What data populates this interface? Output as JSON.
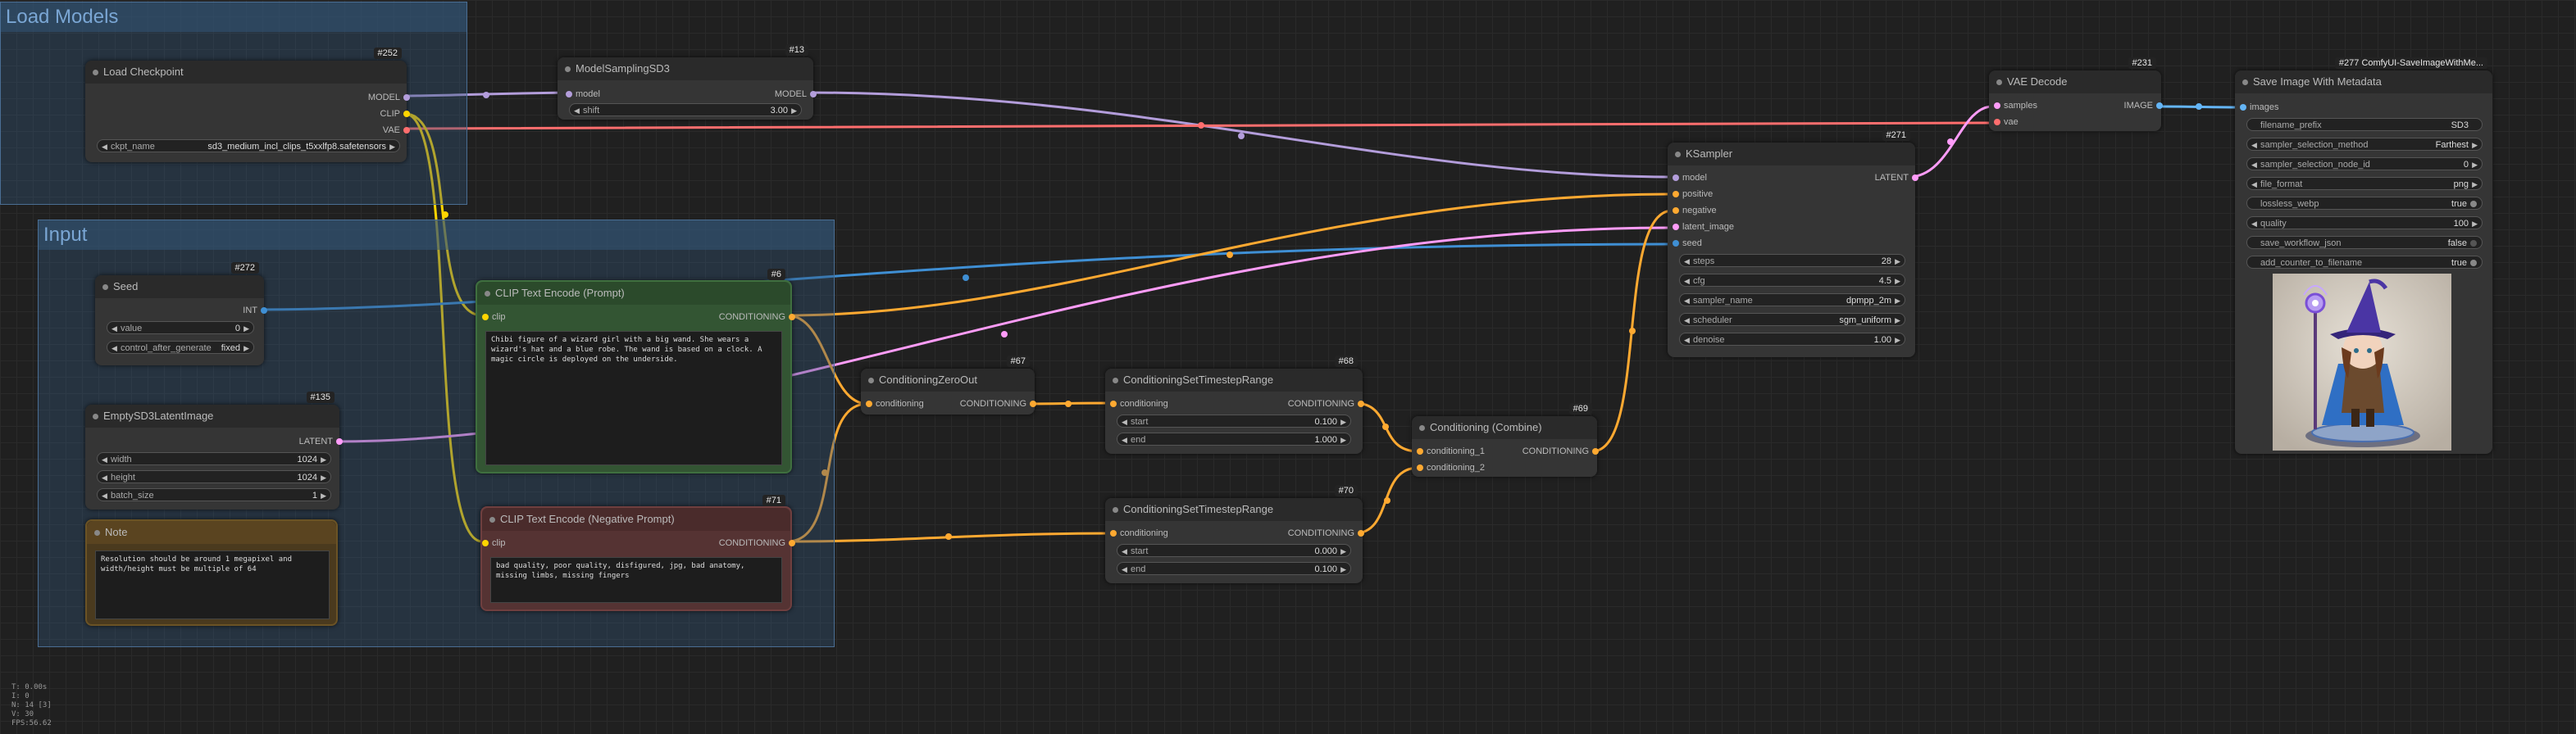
{
  "groups": {
    "load_models": "Load Models",
    "input": "Input"
  },
  "nodes": {
    "load_checkpoint": {
      "id": "#252",
      "title": "Load Checkpoint",
      "out_model": "MODEL",
      "out_clip": "CLIP",
      "out_vae": "VAE",
      "ckpt_label": "ckpt_name",
      "ckpt_value": "sd3_medium_incl_clips_t5xxlfp8.safetensors"
    },
    "model_sampling": {
      "id": "#13",
      "title": "ModelSamplingSD3",
      "in_model": "model",
      "out_model": "MODEL",
      "shift_label": "shift",
      "shift_value": "3.00"
    },
    "seed": {
      "id": "#272",
      "title": "Seed",
      "out_int": "INT",
      "value_label": "value",
      "value": "0",
      "cag_label": "control_after_generate",
      "cag_value": "fixed"
    },
    "latent": {
      "id": "#135",
      "title": "EmptySD3LatentImage",
      "out_latent": "LATENT",
      "width_label": "width",
      "width": "1024",
      "height_label": "height",
      "height": "1024",
      "batch_label": "batch_size",
      "batch": "1"
    },
    "note": {
      "title": "Note",
      "text": "Resolution should be around 1 megapixel and width/height must be multiple of 64"
    },
    "clip_pos": {
      "id": "#6",
      "title": "CLIP Text Encode (Prompt)",
      "in_clip": "clip",
      "out_cond": "CONDITIONING",
      "text": "Chibi figure of a wizard girl with a big wand. She wears a wizard's hat and a blue robe. The wand is based on a clock. A magic circle is deployed on the underside."
    },
    "clip_neg": {
      "id": "#71",
      "title": "CLIP Text Encode (Negative Prompt)",
      "in_clip": "clip",
      "out_cond": "CONDITIONING",
      "text": "bad quality, poor quality, disfigured, jpg, bad anatomy, missing limbs, missing fingers"
    },
    "zero_out": {
      "id": "#67",
      "title": "ConditioningZeroOut",
      "in_cond": "conditioning",
      "out_cond": "CONDITIONING"
    },
    "ts_range1": {
      "id": "#68",
      "title": "ConditioningSetTimestepRange",
      "in_cond": "conditioning",
      "out_cond": "CONDITIONING",
      "start_label": "start",
      "start": "0.100",
      "end_label": "end",
      "end": "1.000"
    },
    "ts_range2": {
      "id": "#70",
      "title": "ConditioningSetTimestepRange",
      "in_cond": "conditioning",
      "out_cond": "CONDITIONING",
      "start_label": "start",
      "start": "0.000",
      "end_label": "end",
      "end": "0.100"
    },
    "combine": {
      "id": "#69",
      "title": "Conditioning (Combine)",
      "in1": "conditioning_1",
      "in2": "conditioning_2",
      "out_cond": "CONDITIONING"
    },
    "ksampler": {
      "id": "#271",
      "title": "KSampler",
      "in_model": "model",
      "in_pos": "positive",
      "in_neg": "negative",
      "in_latent": "latent_image",
      "in_seed": "seed",
      "out_latent": "LATENT",
      "steps_label": "steps",
      "steps": "28",
      "cfg_label": "cfg",
      "cfg": "4.5",
      "sampler_label": "sampler_name",
      "sampler": "dpmpp_2m",
      "scheduler_label": "scheduler",
      "scheduler": "sgm_uniform",
      "denoise_label": "denoise",
      "denoise": "1.00"
    },
    "vae_decode": {
      "id": "#231",
      "title": "VAE Decode",
      "in_samples": "samples",
      "in_vae": "vae",
      "out_image": "IMAGE"
    },
    "save_image": {
      "id": "#277 ComfyUI-SaveImageWithMe...",
      "title": "Save Image With Metadata",
      "in_images": "images",
      "w": [
        {
          "label": "filename_prefix",
          "value": "SD3"
        },
        {
          "label": "sampler_selection_method",
          "value": "Farthest"
        },
        {
          "label": "sampler_selection_node_id",
          "value": "0"
        },
        {
          "label": "file_format",
          "value": "png"
        },
        {
          "label": "lossless_webp",
          "value": "true"
        },
        {
          "label": "quality",
          "value": "100"
        },
        {
          "label": "save_workflow_json",
          "value": "false"
        },
        {
          "label": "add_counter_to_filename",
          "value": "true"
        }
      ]
    }
  },
  "stats": [
    "T: 0.00s",
    "I: 0",
    "N: 14 [3]",
    "V: 30",
    "FPS:56.62"
  ],
  "colors": {
    "model": "#b39ddb",
    "clip": "#ffd500",
    "vae": "#ff6e6e",
    "cond": "#ffa931",
    "latent": "#ff9cf9",
    "int": "#3f8fd4",
    "image": "#64b5f6"
  }
}
